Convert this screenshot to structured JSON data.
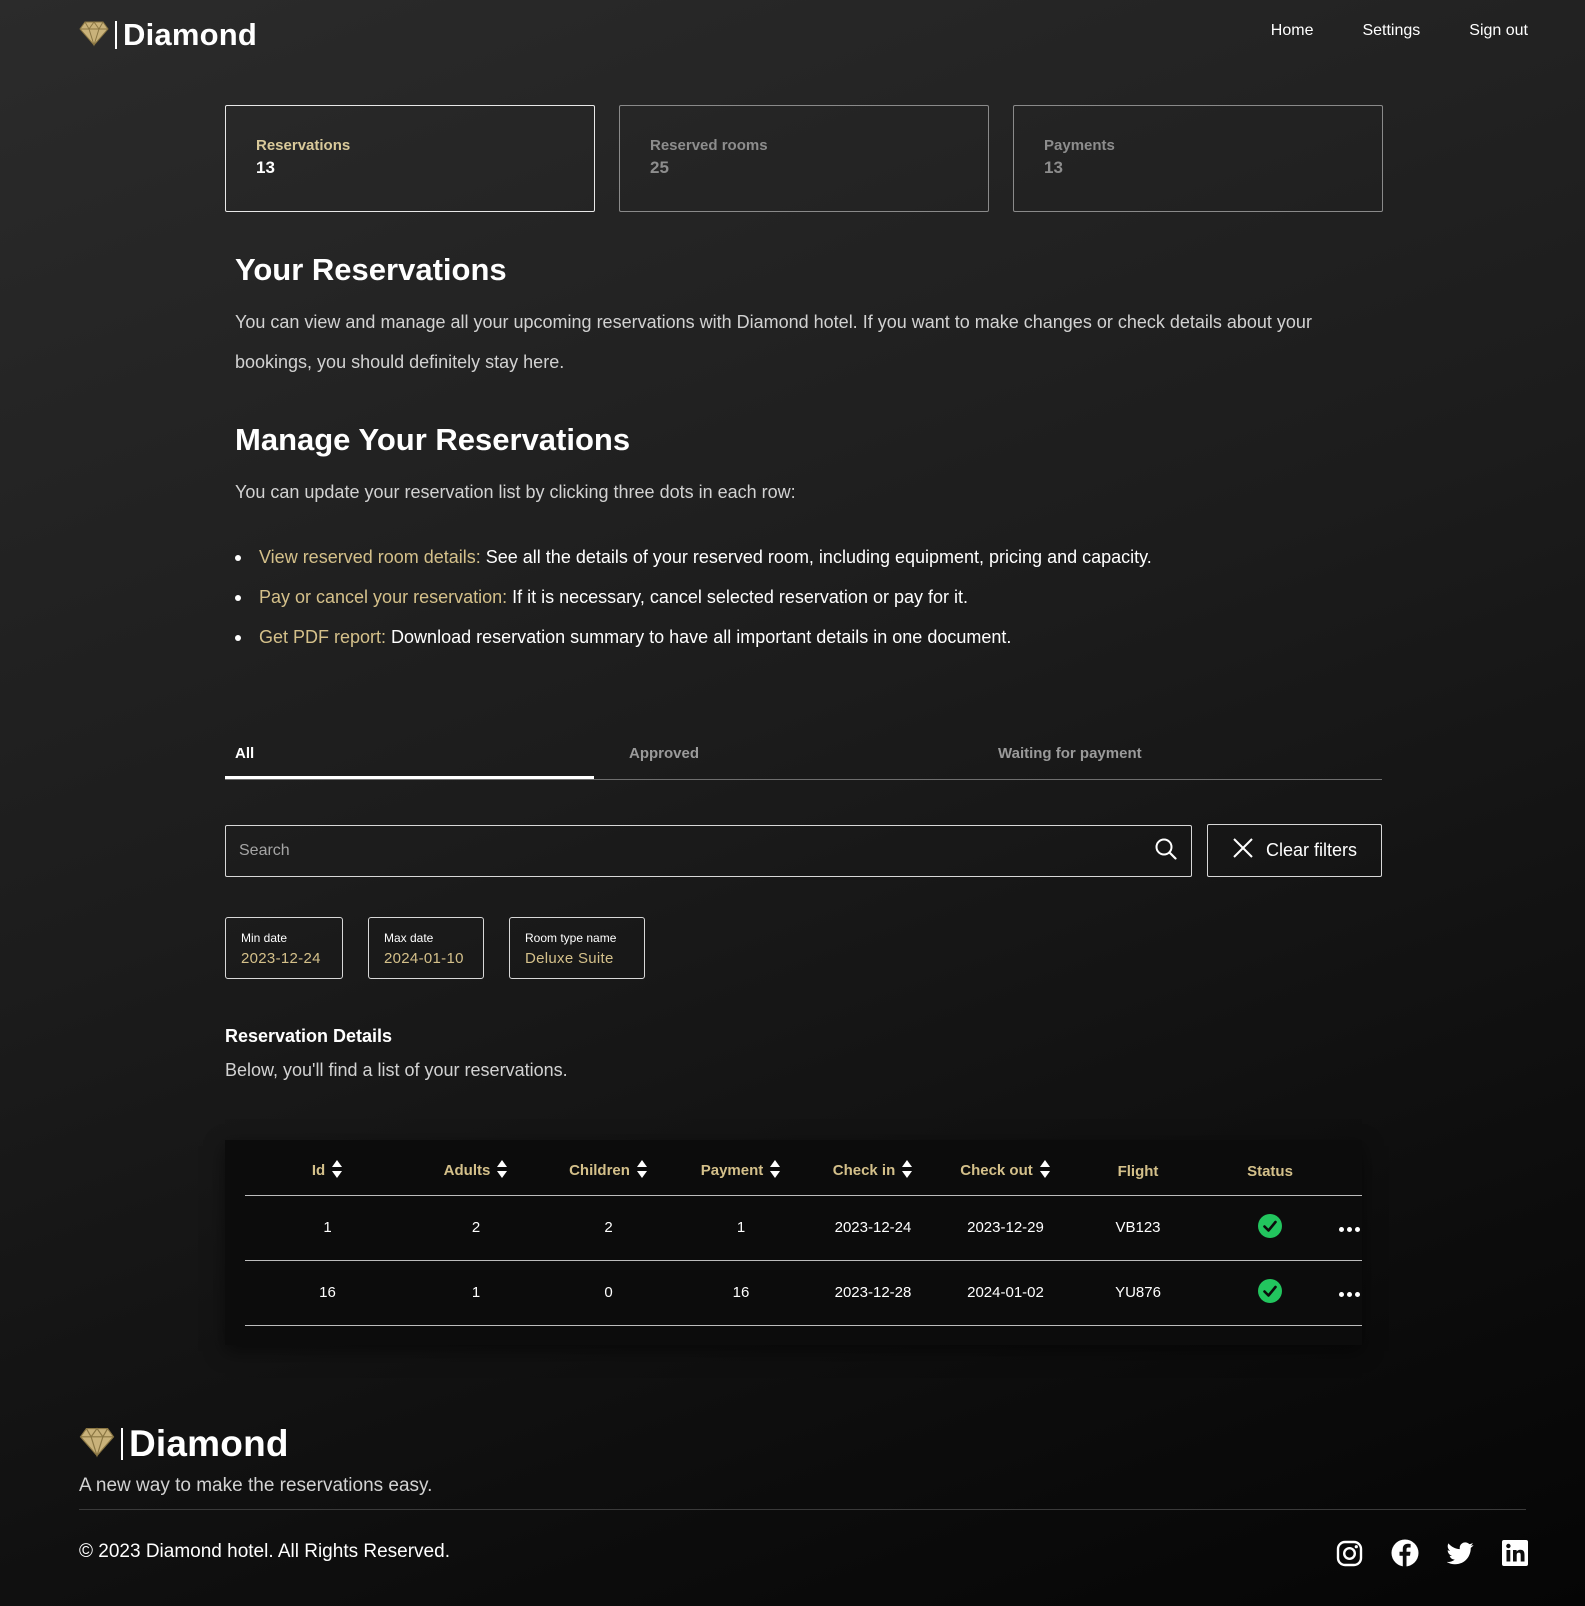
{
  "header": {
    "brand": "Diamond",
    "nav": [
      "Home",
      "Settings",
      "Sign out"
    ]
  },
  "stats": [
    {
      "label": "Reservations",
      "value": "13"
    },
    {
      "label": "Reserved rooms",
      "value": "25"
    },
    {
      "label": "Payments",
      "value": "13"
    }
  ],
  "intro": {
    "title": "Your Reservations",
    "text": "You can view and manage all your upcoming reservations with Diamond hotel. If you want to make changes or check details about your bookings, you should definitely stay here."
  },
  "manage": {
    "title": "Manage Your Reservations",
    "text": "You can update your reservation list by clicking three dots in each row:",
    "items": [
      {
        "label": "View reserved room details:",
        "text": " See all the details of your reserved room, including equipment, pricing and capacity."
      },
      {
        "label": "Pay or cancel your reservation:",
        "text": " If it is necessary, cancel selected reservation or pay for it."
      },
      {
        "label": "Get PDF report:",
        "text": " Download reservation summary to have all important details in one document."
      }
    ]
  },
  "tabs": [
    "All",
    "Approved",
    "Waiting for payment"
  ],
  "search": {
    "placeholder": "Search",
    "clear_label": "Clear filters"
  },
  "filters": [
    {
      "label": "Min date",
      "value": "2023-12-24"
    },
    {
      "label": "Max date",
      "value": "2024-01-10"
    },
    {
      "label": "Room type name",
      "value": "Deluxe Suite"
    }
  ],
  "details": {
    "title": "Reservation Details",
    "subtitle": "Below, you'll find a list of your reservations."
  },
  "table": {
    "headers": [
      "Id",
      "Adults",
      "Children",
      "Payment",
      "Check in",
      "Check out",
      "Flight",
      "Status"
    ],
    "rows": [
      {
        "id": "1",
        "adults": "2",
        "children": "2",
        "payment": "1",
        "check_in": "2023-12-24",
        "check_out": "2023-12-29",
        "flight": "VB123",
        "status": "approved"
      },
      {
        "id": "16",
        "adults": "1",
        "children": "0",
        "payment": "16",
        "check_in": "2023-12-28",
        "check_out": "2024-01-02",
        "flight": "YU876",
        "status": "approved"
      }
    ]
  },
  "footer": {
    "brand": "Diamond",
    "tagline": "A new way to make the reservations easy.",
    "copyright": "© 2023 Diamond hotel. All Rights Reserved.",
    "social": [
      "instagram-icon",
      "facebook-icon",
      "twitter-icon",
      "linkedin-icon"
    ]
  },
  "colors": {
    "accent": "#d4c08a",
    "status_ok": "#22c55e"
  }
}
